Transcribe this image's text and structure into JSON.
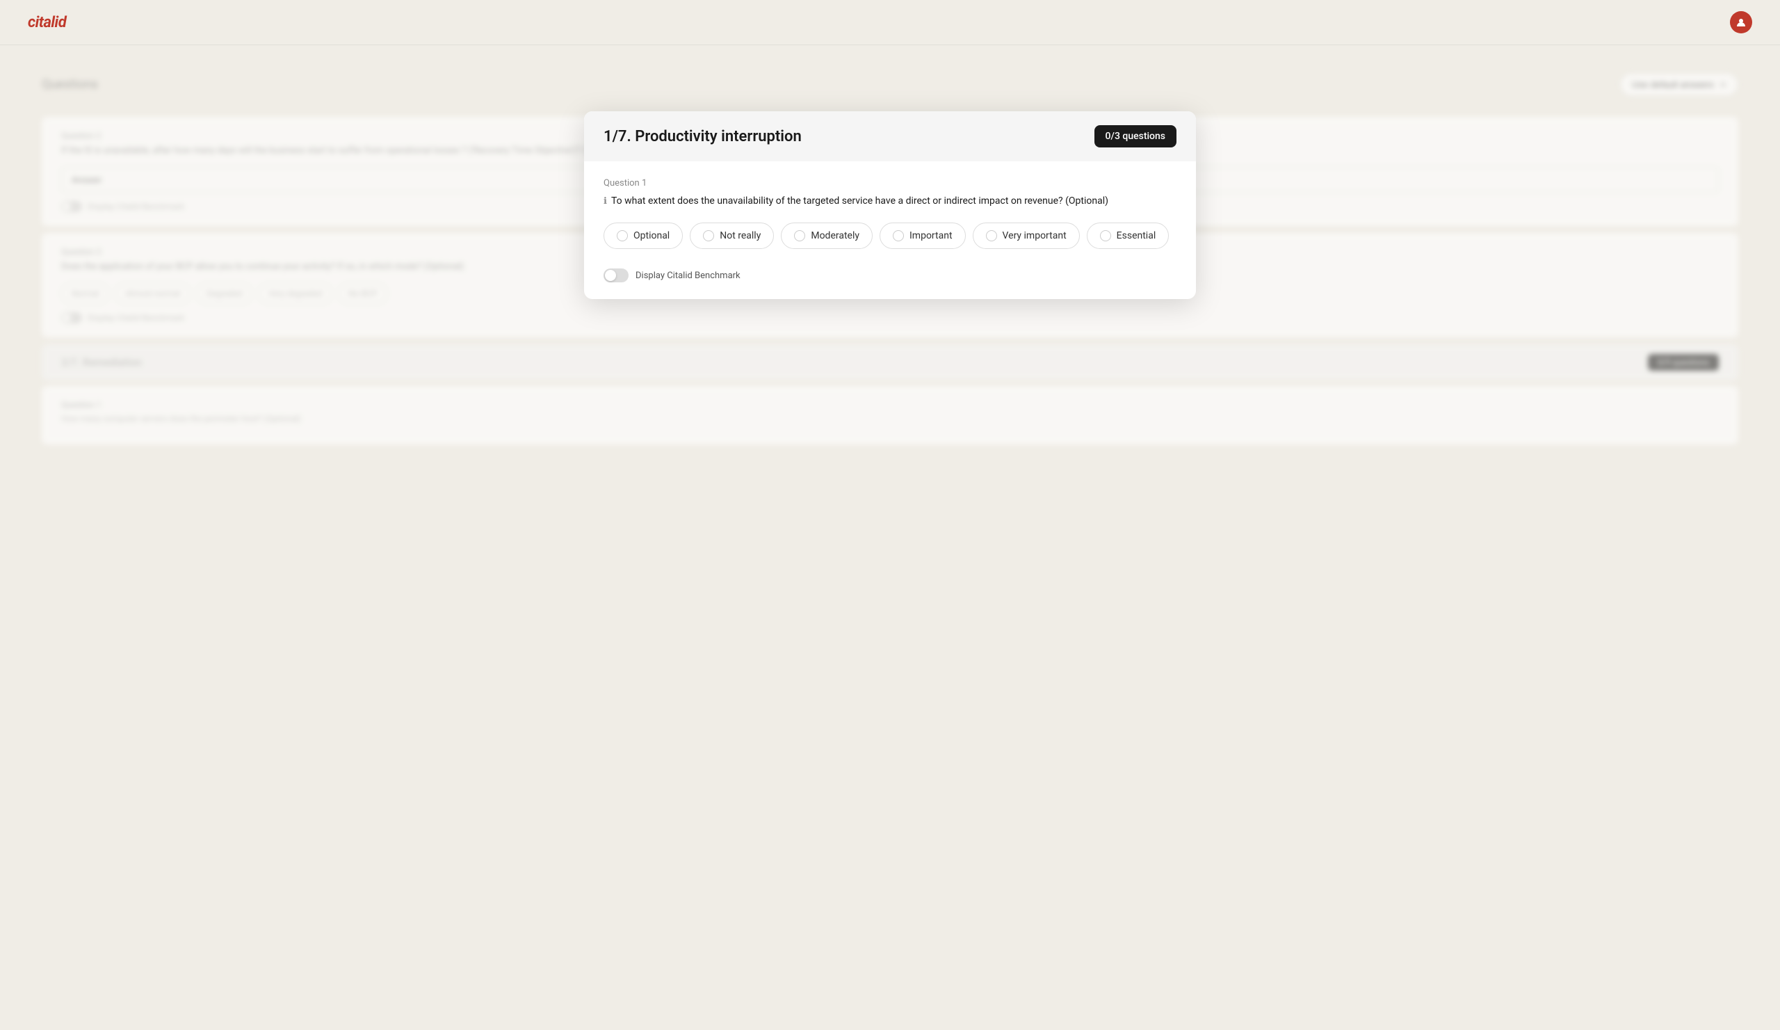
{
  "header": {
    "logo_text": "citalid",
    "avatar_color": "#c0392b"
  },
  "section": {
    "title": "Questions",
    "default_answers_button": "Use default answers"
  },
  "modal": {
    "title": "1/7. Productivity interruption",
    "badge": "0/3 questions",
    "question1": {
      "label": "Question 1",
      "text": "To what extent does the unavailability of the targeted service have a direct or indirect impact on revenue? (Optional)",
      "options": [
        {
          "value": "optional",
          "label": "Optional"
        },
        {
          "value": "not_really",
          "label": "Not really"
        },
        {
          "value": "moderately",
          "label": "Moderately"
        },
        {
          "value": "important",
          "label": "Important"
        },
        {
          "value": "very_important",
          "label": "Very important"
        },
        {
          "value": "essential",
          "label": "Essential"
        }
      ],
      "toggle_label": "Display Citalid Benchmark"
    }
  },
  "background": {
    "question2": {
      "label": "Question 2",
      "text": "If the IS is unavailable, after how many days will the business start to suffer from operational losses ? ('Recovery Time Objective')? (Optional)",
      "input_placeholder": "Answer",
      "toggle_label": "Display Citalid Benchmark"
    },
    "question3": {
      "label": "Question 3",
      "text": "Does the application of your BCP allow you to continue your activity? If so, in which mode? (Optional)",
      "options": [
        "Normal",
        "Almost normal",
        "Degraded",
        "Very degraded",
        "No BCP"
      ],
      "toggle_label": "Display Citalid Benchmark"
    },
    "section2": {
      "title": "2/7. Remediation",
      "badge": "0/9 questions"
    },
    "question4": {
      "label": "Question 1",
      "text": "How many computer servers does the perimeter host? (Optional)"
    }
  }
}
